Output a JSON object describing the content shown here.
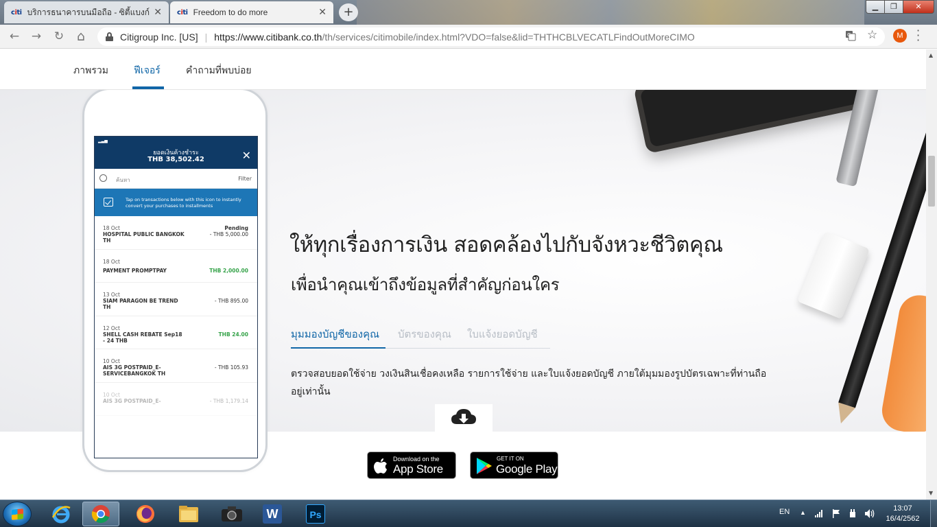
{
  "browser": {
    "tabs": [
      {
        "favicon": "citi",
        "title": "บริการธนาคารบนมือถือ - ซิตี้แบงก์ ประเทศไทย",
        "active": false
      },
      {
        "favicon": "citi",
        "title": "Freedom to do more",
        "active": true
      }
    ],
    "new_tab_label": "+",
    "window_controls": {
      "minimize": "▁",
      "maximize": "❐",
      "close": "✕"
    },
    "nav": {
      "back": "←",
      "forward": "→",
      "reload": "↻",
      "home": "⌂"
    },
    "address": {
      "org": "Citigroup Inc. [US]",
      "host": "https://www.citibank.co.th",
      "path": "/th/services/citimobile/index.html?VDO=false&lid=THTHCBLVECATLFindOutMoreCIMO"
    },
    "translate_icon": "translate-icon",
    "star_icon": "☆",
    "profile_initial": "M",
    "menu_icon": "⋮"
  },
  "page": {
    "subnav": [
      {
        "label": "ภาพรวม",
        "active": false
      },
      {
        "label": "ฟีเจอร์",
        "active": true
      },
      {
        "label": "คำถามที่พบบ่อย",
        "active": false
      }
    ],
    "phone": {
      "header_title": "ยอดเงินค้างชำระ",
      "header_amount": "THB 38,502.42",
      "search_placeholder": "ค้นหา",
      "filter_label": "Filter",
      "info_text": "Tap on transactions below with this icon to instantly convert your purchases to installments",
      "transactions": [
        {
          "date": "18 Oct",
          "name": "HOSPITAL PUBLIC BANGKOK TH",
          "status": "Pending",
          "amount": "- THB 5,000.00",
          "positive": false
        },
        {
          "date": "18 Oct",
          "name": "PAYMENT PROMPTPAY",
          "status": "",
          "amount": "THB 2,000.00",
          "positive": true
        },
        {
          "date": "13 Oct",
          "name": "SIAM PARAGON BE TREND TH",
          "status": "",
          "amount": "- THB 895.00",
          "positive": false
        },
        {
          "date": "12 Oct",
          "name": "SHELL CASH REBATE Sep18 - 24 THB",
          "status": "",
          "amount": "THB 24.00",
          "positive": true
        },
        {
          "date": "10 Oct",
          "name": "AIS 3G POSTPAID_E-SERVICEBANGKOK TH",
          "status": "",
          "amount": "- THB 105.93",
          "positive": false
        },
        {
          "date": "10 Oct",
          "name": "AIS 3G POSTPAID_E-",
          "status": "",
          "amount": "- THB 1,179.14",
          "positive": false
        }
      ]
    },
    "headline": "ให้ทุกเรื่องการเงิน สอดคล้องไปกับจังหวะชีวิตคุณ",
    "subheadline": "เพื่อนำคุณเข้าถึงข้อมูลที่สำคัญก่อนใคร",
    "feature_tabs": [
      {
        "label": "มุมมองบัญชีของคุณ",
        "active": true
      },
      {
        "label": "บัตรของคุณ",
        "active": false
      },
      {
        "label": "ใบแจ้งยอดบัญชี",
        "active": false
      }
    ],
    "description": "ตรวจสอบยอดใช้จ่าย วงเงินสินเชื่อคงเหลือ รายการใช้จ่าย และใบแจ้งยอดบัญชี ภายใต้มุมมองรูปบัตรเฉพาะที่ท่านถืออยู่เท่านั้น",
    "download_icon": "cloud-download-icon",
    "app_store": {
      "small": "Download on the",
      "big": "App Store"
    },
    "google_play": {
      "small": "GET IT ON",
      "big": "Google Play"
    }
  },
  "taskbar": {
    "apps": [
      "ie-icon",
      "chrome-icon",
      "firefox-icon",
      "file-explorer-icon",
      "camera-icon",
      "word-icon",
      "photoshop-icon"
    ],
    "word_letter": "W",
    "ps_letter": "Ps",
    "language": "EN",
    "time": "13:07",
    "date": "16/4/2562"
  },
  "colors": {
    "accent": "#1066a7",
    "citi_navy": "#0f3a66",
    "positive": "#36a34a"
  }
}
